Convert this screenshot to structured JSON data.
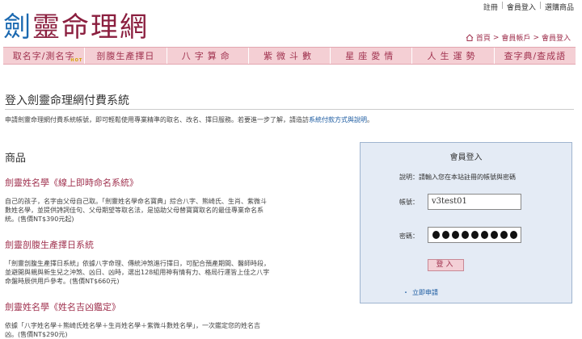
{
  "toplinks": {
    "register": "註冊",
    "sep": "|",
    "member_login": "會員登入",
    "selected": "選購商品"
  },
  "logo": {
    "chars": [
      "劍",
      "靈",
      "命",
      "理",
      "網"
    ]
  },
  "breadcrumb": {
    "home": "首頁",
    "account": "會員帳戶",
    "current": "會員登入",
    "sep": ">"
  },
  "nav": {
    "items": [
      {
        "label": "取名字/測名字",
        "badge": "HOT"
      },
      {
        "label": "剖腹生產擇日"
      },
      {
        "label": "八字算命"
      },
      {
        "label": "紫微斗數"
      },
      {
        "label": "星座愛情"
      },
      {
        "label": "人生運勢"
      },
      {
        "label": "查字典/查成語"
      }
    ]
  },
  "page": {
    "title": "登入劍靈命理網付費系統",
    "intro_prefix": "申請劍靈命理網付費系統帳號，即可輕鬆使用專業精準的取名、改名、擇日服務。若要進一步了解，請造訪",
    "intro_link": "系統付款方式與說明",
    "intro_suffix": "。"
  },
  "products": {
    "heading": "商品",
    "items": [
      {
        "title": "劍靈姓名學《線上即時命名系統》",
        "desc": "自己的孩子，名字由父母自己取。「劍靈姓名學命名寶典」綜合八字、熊崎氏、生肖、紫微斗數姓名學，並提供詩詞佳句、父母期望等取名法，是協助父母替寶寶取名的最佳專業命名系統。(售價NT$390元起)"
      },
      {
        "title": "劍靈剖腹生產擇日系統",
        "desc": "「劍靈剖腹生產擇日系統」依據八字命理、傳統沖煞進行擇日，可配合預產期間、醫師時段，並避開與親與新生兒之沖煞、凶日、凶時，選出128組用神有情有力、格局行運皆上佳之八字命盤時辰供用戶參考。(售價NT$660元)"
      },
      {
        "title": "劍靈姓名學《姓名吉凶鑑定》",
        "desc": "依據「八字姓名學＋熊崎氏姓名學＋生肖姓名學＋紫微斗數姓名學」，一次鑑定您的姓名吉凶。(售價NT$290元)"
      }
    ]
  },
  "login": {
    "title": "會員登入",
    "hint": "說明：請輸入您在本站註冊的帳號與密碼",
    "username_label": "帳號：",
    "username_value": "v3test01",
    "password_label": "密碼：",
    "password_length": 9,
    "submit_label": "登入",
    "register_bullet": "・",
    "register_label": "立即申請"
  },
  "colors": {
    "brand": "#a0324f",
    "nav_bg": "#f4cfd4",
    "login_bg": "#e4ebf5",
    "link": "#1a5aa0"
  }
}
